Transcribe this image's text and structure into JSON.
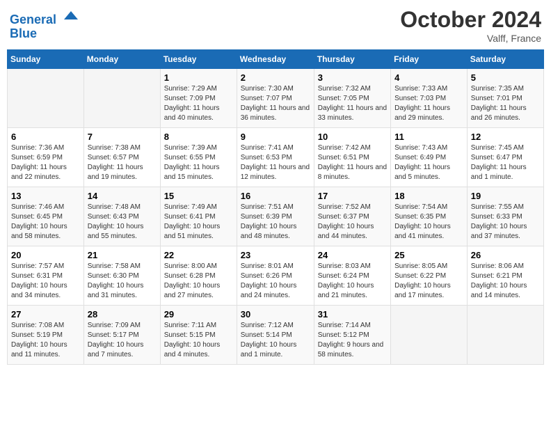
{
  "header": {
    "logo_line1": "General",
    "logo_line2": "Blue",
    "month_title": "October 2024",
    "location": "Valff, France"
  },
  "days_of_week": [
    "Sunday",
    "Monday",
    "Tuesday",
    "Wednesday",
    "Thursday",
    "Friday",
    "Saturday"
  ],
  "weeks": [
    [
      {
        "day": "",
        "info": ""
      },
      {
        "day": "",
        "info": ""
      },
      {
        "day": "1",
        "info": "Sunrise: 7:29 AM\nSunset: 7:09 PM\nDaylight: 11 hours and 40 minutes."
      },
      {
        "day": "2",
        "info": "Sunrise: 7:30 AM\nSunset: 7:07 PM\nDaylight: 11 hours and 36 minutes."
      },
      {
        "day": "3",
        "info": "Sunrise: 7:32 AM\nSunset: 7:05 PM\nDaylight: 11 hours and 33 minutes."
      },
      {
        "day": "4",
        "info": "Sunrise: 7:33 AM\nSunset: 7:03 PM\nDaylight: 11 hours and 29 minutes."
      },
      {
        "day": "5",
        "info": "Sunrise: 7:35 AM\nSunset: 7:01 PM\nDaylight: 11 hours and 26 minutes."
      }
    ],
    [
      {
        "day": "6",
        "info": "Sunrise: 7:36 AM\nSunset: 6:59 PM\nDaylight: 11 hours and 22 minutes."
      },
      {
        "day": "7",
        "info": "Sunrise: 7:38 AM\nSunset: 6:57 PM\nDaylight: 11 hours and 19 minutes."
      },
      {
        "day": "8",
        "info": "Sunrise: 7:39 AM\nSunset: 6:55 PM\nDaylight: 11 hours and 15 minutes."
      },
      {
        "day": "9",
        "info": "Sunrise: 7:41 AM\nSunset: 6:53 PM\nDaylight: 11 hours and 12 minutes."
      },
      {
        "day": "10",
        "info": "Sunrise: 7:42 AM\nSunset: 6:51 PM\nDaylight: 11 hours and 8 minutes."
      },
      {
        "day": "11",
        "info": "Sunrise: 7:43 AM\nSunset: 6:49 PM\nDaylight: 11 hours and 5 minutes."
      },
      {
        "day": "12",
        "info": "Sunrise: 7:45 AM\nSunset: 6:47 PM\nDaylight: 11 hours and 1 minute."
      }
    ],
    [
      {
        "day": "13",
        "info": "Sunrise: 7:46 AM\nSunset: 6:45 PM\nDaylight: 10 hours and 58 minutes."
      },
      {
        "day": "14",
        "info": "Sunrise: 7:48 AM\nSunset: 6:43 PM\nDaylight: 10 hours and 55 minutes."
      },
      {
        "day": "15",
        "info": "Sunrise: 7:49 AM\nSunset: 6:41 PM\nDaylight: 10 hours and 51 minutes."
      },
      {
        "day": "16",
        "info": "Sunrise: 7:51 AM\nSunset: 6:39 PM\nDaylight: 10 hours and 48 minutes."
      },
      {
        "day": "17",
        "info": "Sunrise: 7:52 AM\nSunset: 6:37 PM\nDaylight: 10 hours and 44 minutes."
      },
      {
        "day": "18",
        "info": "Sunrise: 7:54 AM\nSunset: 6:35 PM\nDaylight: 10 hours and 41 minutes."
      },
      {
        "day": "19",
        "info": "Sunrise: 7:55 AM\nSunset: 6:33 PM\nDaylight: 10 hours and 37 minutes."
      }
    ],
    [
      {
        "day": "20",
        "info": "Sunrise: 7:57 AM\nSunset: 6:31 PM\nDaylight: 10 hours and 34 minutes."
      },
      {
        "day": "21",
        "info": "Sunrise: 7:58 AM\nSunset: 6:30 PM\nDaylight: 10 hours and 31 minutes."
      },
      {
        "day": "22",
        "info": "Sunrise: 8:00 AM\nSunset: 6:28 PM\nDaylight: 10 hours and 27 minutes."
      },
      {
        "day": "23",
        "info": "Sunrise: 8:01 AM\nSunset: 6:26 PM\nDaylight: 10 hours and 24 minutes."
      },
      {
        "day": "24",
        "info": "Sunrise: 8:03 AM\nSunset: 6:24 PM\nDaylight: 10 hours and 21 minutes."
      },
      {
        "day": "25",
        "info": "Sunrise: 8:05 AM\nSunset: 6:22 PM\nDaylight: 10 hours and 17 minutes."
      },
      {
        "day": "26",
        "info": "Sunrise: 8:06 AM\nSunset: 6:21 PM\nDaylight: 10 hours and 14 minutes."
      }
    ],
    [
      {
        "day": "27",
        "info": "Sunrise: 7:08 AM\nSunset: 5:19 PM\nDaylight: 10 hours and 11 minutes."
      },
      {
        "day": "28",
        "info": "Sunrise: 7:09 AM\nSunset: 5:17 PM\nDaylight: 10 hours and 7 minutes."
      },
      {
        "day": "29",
        "info": "Sunrise: 7:11 AM\nSunset: 5:15 PM\nDaylight: 10 hours and 4 minutes."
      },
      {
        "day": "30",
        "info": "Sunrise: 7:12 AM\nSunset: 5:14 PM\nDaylight: 10 hours and 1 minute."
      },
      {
        "day": "31",
        "info": "Sunrise: 7:14 AM\nSunset: 5:12 PM\nDaylight: 9 hours and 58 minutes."
      },
      {
        "day": "",
        "info": ""
      },
      {
        "day": "",
        "info": ""
      }
    ]
  ]
}
